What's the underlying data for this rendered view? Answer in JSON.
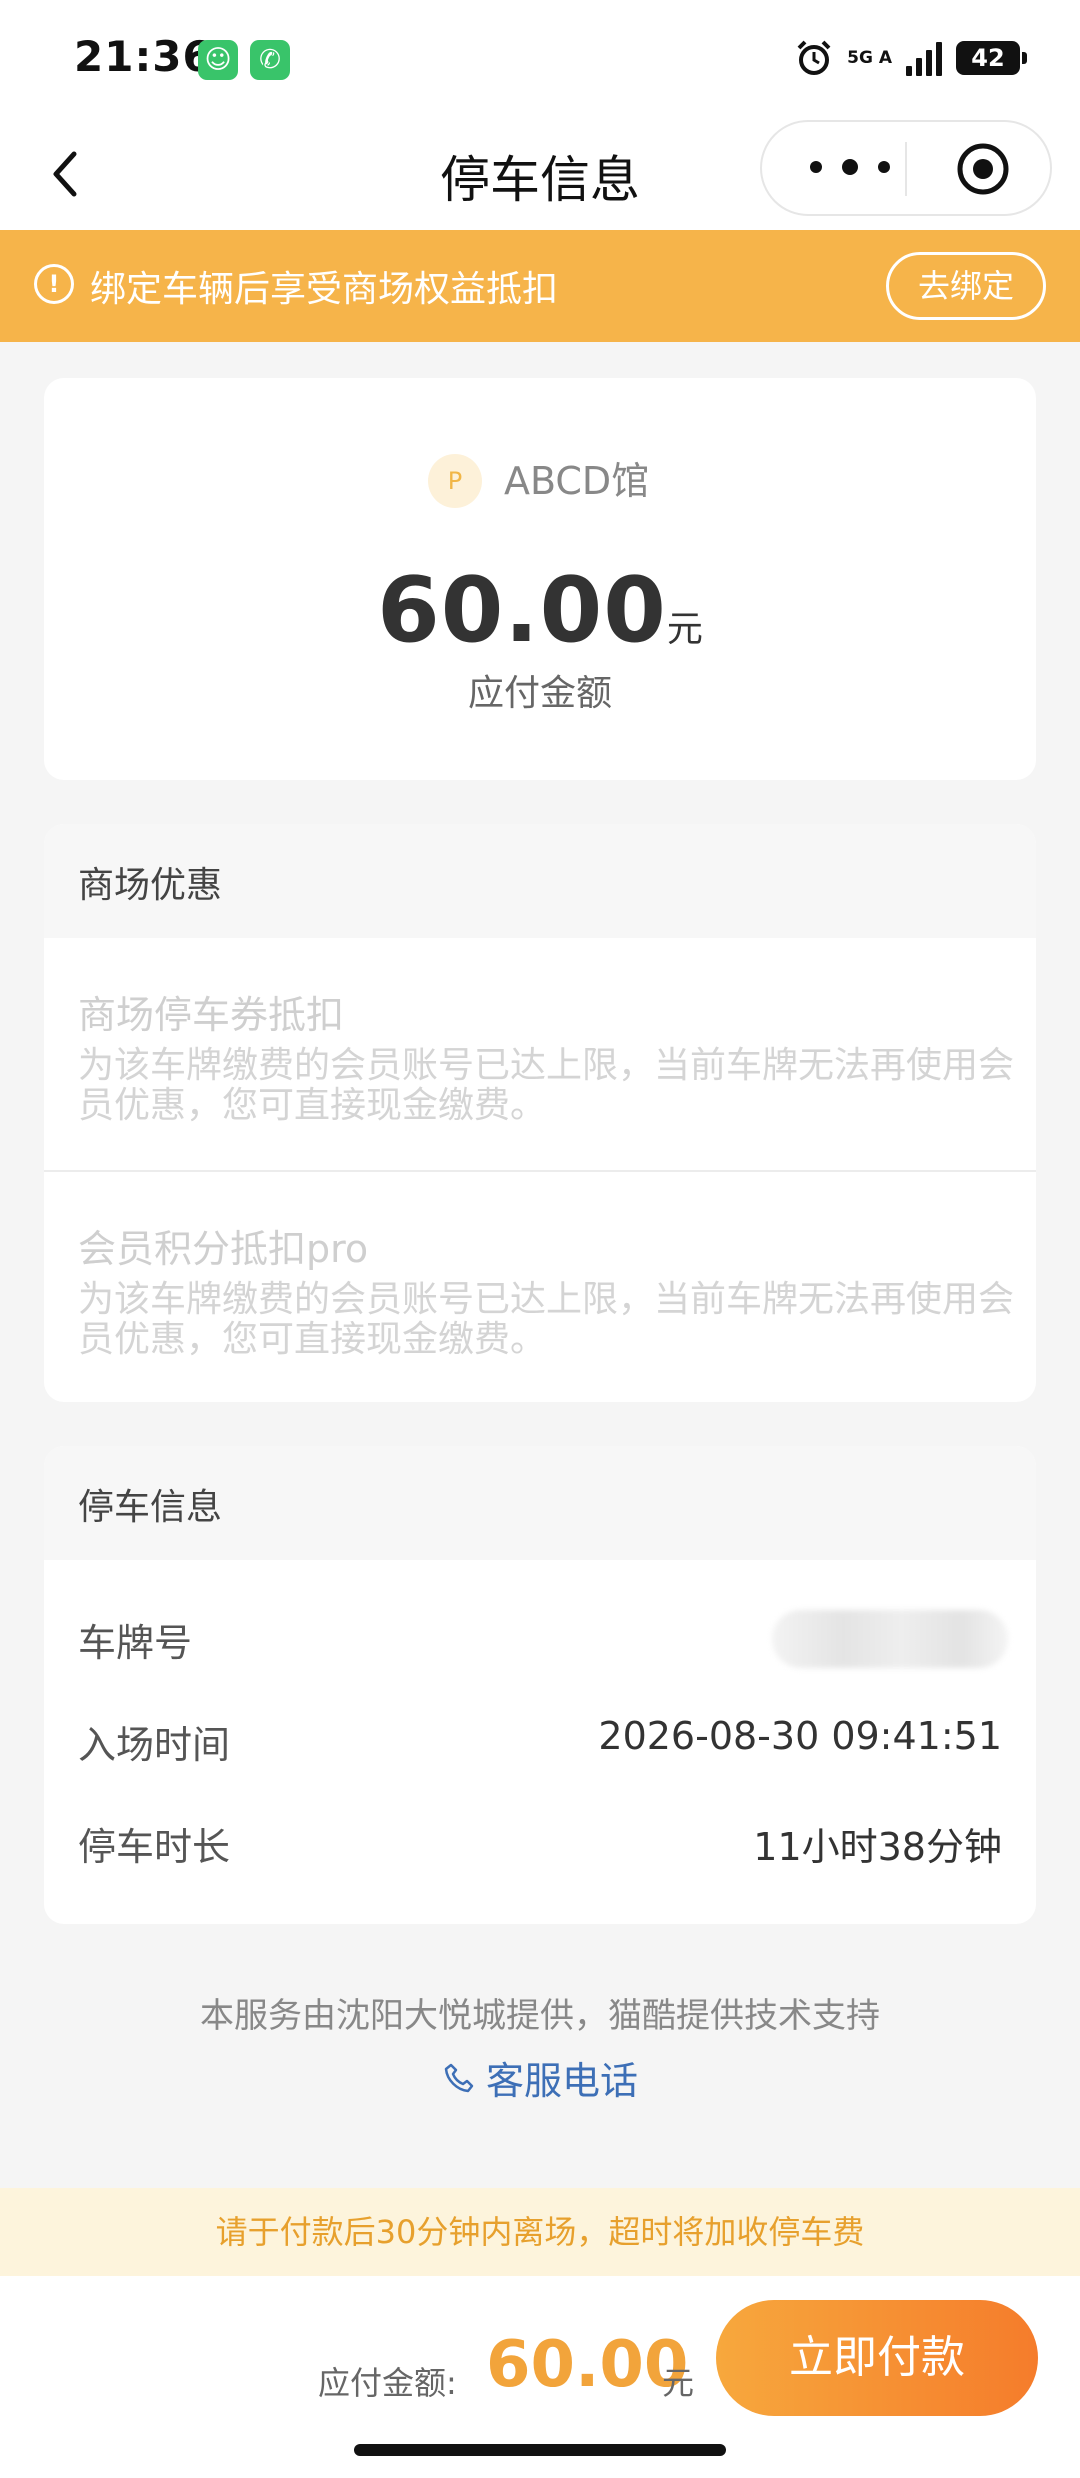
{
  "status_bar": {
    "time": "21:36",
    "network": "5G A",
    "battery": "42"
  },
  "nav": {
    "title": "停车信息",
    "more_icon": "more-dots-icon",
    "record_icon": "record-target-icon"
  },
  "banner": {
    "text": "绑定车辆后享受商场权益抵扣",
    "button": "去绑定"
  },
  "amount_card": {
    "park_icon_letter": "P",
    "park_name": "ABCD馆",
    "amount": "60.00",
    "unit": "元",
    "label": "应付金额"
  },
  "discounts": {
    "title": "商场优惠",
    "items": [
      {
        "title": "商场停车券抵扣",
        "desc": "为该车牌缴费的会员账号已达上限，当前车牌无法再使用会员优惠，您可直接现金缴费。"
      },
      {
        "title": "会员积分抵扣pro",
        "desc": "为该车牌缴费的会员账号已达上限，当前车牌无法再使用会员优惠，您可直接现金缴费。"
      }
    ]
  },
  "parking_info": {
    "title": "停车信息",
    "rows": [
      {
        "label": "车牌号",
        "value": ""
      },
      {
        "label": "入场时间",
        "value": "2026-08-30 09:41:51"
      },
      {
        "label": "停车时长",
        "value": "11小时38分钟"
      }
    ]
  },
  "footer": {
    "note": "本服务由沈阳大悦城提供，猫酷提供技术支持",
    "service_phone": "客服电话"
  },
  "notice": "请于付款后30分钟内离场，超时将加收停车费",
  "bottom_bar": {
    "label": "应付金额:",
    "amount": "60.00",
    "unit": "元",
    "pay_button": "立即付款"
  },
  "colors": {
    "accent": "#f6b44a",
    "pay_gradient_start": "#f7a83d",
    "pay_gradient_end": "#f57c2b",
    "link": "#3d6fb6"
  }
}
